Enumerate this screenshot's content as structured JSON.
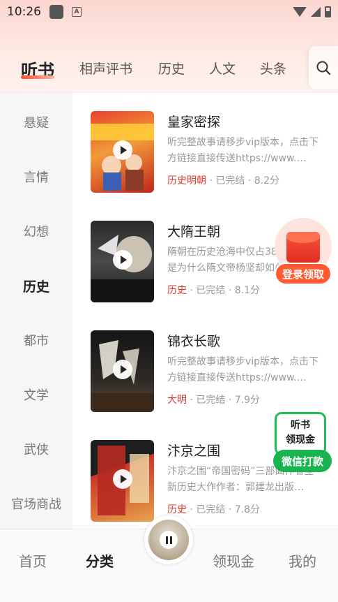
{
  "status_bar": {
    "time": "10:26",
    "a_badge": "A"
  },
  "tabs": [
    {
      "label": "听书",
      "active": true
    },
    {
      "label": "相声评书"
    },
    {
      "label": "历史"
    },
    {
      "label": "人文"
    },
    {
      "label": "头条"
    }
  ],
  "sidebar": {
    "items": [
      {
        "label": "悬疑"
      },
      {
        "label": "言情"
      },
      {
        "label": "幻想"
      },
      {
        "label": "历史",
        "active": true
      },
      {
        "label": "都市"
      },
      {
        "label": "文学"
      },
      {
        "label": "武侠"
      },
      {
        "label": "官场商战"
      }
    ]
  },
  "books": [
    {
      "title": "皇家密探",
      "desc": "听完整故事请移步vip版本，点击下方链接直接传送https://www.…",
      "tag": "历史明朝",
      "status": "已完结",
      "score": "8.2分"
    },
    {
      "title": "大隋王朝",
      "desc": "隋朝在历史沧海中仅占38年，但这是为什么隋文帝杨坚却如此",
      "tag": "历史",
      "status": "已完结",
      "score": "8.1分"
    },
    {
      "title": "锦衣长歌",
      "desc": "听完整故事请移步vip版本，点击下方链接直接传送https://www.…",
      "tag": "大明",
      "status": "已完结",
      "score": "7.9分"
    },
    {
      "title": "汴京之围",
      "desc": "汴京之围“帝国密码”三部曲作者全新历史大作作者：郭建龙出版…",
      "tag": "历史",
      "status": "已完结",
      "score": "7.8分"
    }
  ],
  "meta_sep": "·",
  "floating": {
    "login_reward": "登录领取",
    "cash_line1": "听书",
    "cash_line2": "领现金",
    "wechat_cash": "微信打款"
  },
  "bottom_nav": [
    {
      "label": "首页"
    },
    {
      "label": "分类",
      "active": true
    },
    {
      "label": "领现金"
    },
    {
      "label": "我的"
    }
  ],
  "colors": {
    "accent_red": "#e03a2e",
    "accent_green": "#19b350",
    "header_gradient_top": "#fbd6cf"
  },
  "icons": {
    "search": "search-icon",
    "play": "play-icon",
    "pause": "pause-icon",
    "hongbao": "red-envelope-icon"
  }
}
